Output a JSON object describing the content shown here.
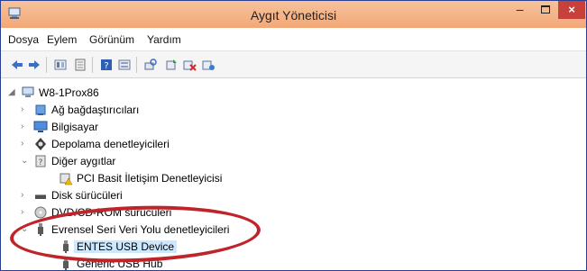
{
  "window": {
    "title": "Aygıt Yöneticisi",
    "minimize_symbol": "–",
    "close_symbol": "×"
  },
  "menu": [
    "Dosya",
    "Eylem",
    "Görünüm",
    "Yardım"
  ],
  "toolbar": [
    "back-arrow-icon",
    "forward-arrow-icon",
    "properties-icon",
    "sheet-icon",
    "help-icon",
    "device-grid-icon",
    "scan-icon",
    "update-driver-icon",
    "disable-device-icon",
    "uninstall-device-icon"
  ],
  "tree": {
    "root": "W8-1Prox86",
    "items": [
      {
        "label": "Ağ bağdaştırıcıları",
        "expander": "›"
      },
      {
        "label": "Bilgisayar",
        "expander": "›"
      },
      {
        "label": "Depolama denetleyicileri",
        "expander": "›"
      },
      {
        "label": "Diğer aygıtlar",
        "expander": "⌄"
      },
      {
        "label": "PCI Basit İletişim Denetleyicisi",
        "expander": ""
      },
      {
        "label": "Disk sürücüleri",
        "expander": "›"
      },
      {
        "label": "DVD/CD-ROM sürücüleri",
        "expander": "›"
      },
      {
        "label": "Evrensel Seri Veri Yolu denetleyicileri",
        "expander": "⌄"
      },
      {
        "label": "ENTES USB Device",
        "expander": ""
      },
      {
        "label": "Generic USB Hub",
        "expander": ""
      }
    ]
  },
  "colors": {
    "titlebar": "#f2a877",
    "close": "#c7413a",
    "annotation": "#c0242b",
    "selection": "#cce8ff"
  }
}
